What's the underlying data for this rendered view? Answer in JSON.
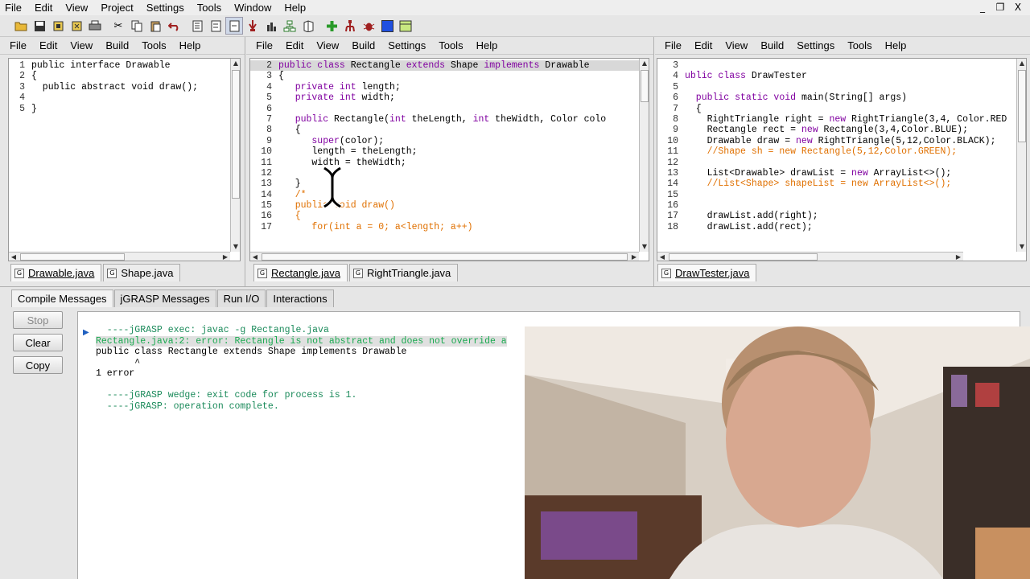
{
  "app_menu": [
    "File",
    "Edit",
    "View",
    "Project",
    "Settings",
    "Tools",
    "Window",
    "Help"
  ],
  "window_controls": [
    "_",
    "❐",
    "X"
  ],
  "toolbar_icons": [
    "open-folder-icon",
    "save-icon",
    "open-file-icon",
    "close-file-icon",
    "print-icon",
    "cut-icon",
    "copy-icon",
    "paste-icon",
    "undo-icon",
    "generate-csd-icon",
    "remove-csd-icon",
    "fold-icon",
    "browse-icon",
    "compile-icon",
    "uml-icon",
    "jar-icon",
    "compile-plus-icon",
    "debug-icon",
    "bug-icon",
    "run-icon",
    "window-icon"
  ],
  "panes": [
    {
      "menu": [
        "File",
        "Edit",
        "View",
        "Build",
        "Tools",
        "Help"
      ],
      "lines": [
        {
          "n": "1",
          "parts": [
            [
              "pl",
              "public interface Drawable"
            ]
          ]
        },
        {
          "n": "2",
          "parts": [
            [
              "pl",
              "{"
            ]
          ]
        },
        {
          "n": "3",
          "parts": [
            [
              "pl",
              "  public abstract void draw();"
            ]
          ]
        },
        {
          "n": "4",
          "parts": [
            [
              "pl",
              ""
            ]
          ]
        },
        {
          "n": "5",
          "parts": [
            [
              "pl",
              "}"
            ]
          ]
        }
      ],
      "tabs": [
        "Drawable.java",
        "Shape.java"
      ]
    },
    {
      "menu": [
        "File",
        "Edit",
        "View",
        "Build",
        "Settings",
        "Tools",
        "Help"
      ],
      "lines": [
        {
          "n": "2",
          "parts": [
            [
              "kw",
              "public class "
            ],
            [
              "pl",
              "Rectangle "
            ],
            [
              "kw",
              "extends "
            ],
            [
              "pl",
              "Shape "
            ],
            [
              "kw",
              "implements "
            ],
            [
              "pl",
              "Drawable"
            ]
          ],
          "hl": true
        },
        {
          "n": "3",
          "parts": [
            [
              "pl",
              "{"
            ]
          ]
        },
        {
          "n": "4",
          "parts": [
            [
              "kw",
              "   private int "
            ],
            [
              "pl",
              "length;"
            ]
          ]
        },
        {
          "n": "5",
          "parts": [
            [
              "kw",
              "   private int "
            ],
            [
              "pl",
              "width;"
            ]
          ]
        },
        {
          "n": "6",
          "parts": [
            [
              "pl",
              ""
            ]
          ]
        },
        {
          "n": "7",
          "parts": [
            [
              "kw",
              "   public "
            ],
            [
              "pl",
              "Rectangle("
            ],
            [
              "kw",
              "int "
            ],
            [
              "pl",
              "theLength, "
            ],
            [
              "kw",
              "int "
            ],
            [
              "pl",
              "theWidth, Color colo"
            ]
          ]
        },
        {
          "n": "8",
          "parts": [
            [
              "pl",
              "   {"
            ]
          ]
        },
        {
          "n": "9",
          "parts": [
            [
              "kw",
              "      super"
            ],
            [
              "pl",
              "(color);"
            ]
          ]
        },
        {
          "n": "10",
          "parts": [
            [
              "pl",
              "      length = theLength;"
            ]
          ]
        },
        {
          "n": "11",
          "parts": [
            [
              "pl",
              "      width = theWidth;"
            ]
          ]
        },
        {
          "n": "12",
          "parts": [
            [
              "pl",
              ""
            ]
          ]
        },
        {
          "n": "13",
          "parts": [
            [
              "pl",
              "   }"
            ]
          ]
        },
        {
          "n": "14",
          "parts": [
            [
              "cm",
              "   /*"
            ]
          ]
        },
        {
          "n": "15",
          "parts": [
            [
              "cm",
              "   public void draw()"
            ]
          ]
        },
        {
          "n": "16",
          "parts": [
            [
              "cm",
              "   {"
            ]
          ]
        },
        {
          "n": "17",
          "parts": [
            [
              "cm",
              "      for(int a = 0; a<length; a++)"
            ]
          ]
        }
      ],
      "tabs": [
        "Rectangle.java",
        "RightTriangle.java"
      ]
    },
    {
      "menu": [
        "File",
        "Edit",
        "View",
        "Build",
        "Settings",
        "Tools",
        "Help"
      ],
      "lines": [
        {
          "n": "3",
          "parts": [
            [
              "pl",
              ""
            ]
          ]
        },
        {
          "n": "4",
          "parts": [
            [
              "kw",
              "ublic class "
            ],
            [
              "pl",
              "DrawTester"
            ]
          ]
        },
        {
          "n": "5",
          "parts": [
            [
              "pl",
              ""
            ]
          ]
        },
        {
          "n": "6",
          "parts": [
            [
              "kw",
              "  public static void "
            ],
            [
              "pl",
              "main(String[] args)"
            ]
          ]
        },
        {
          "n": "7",
          "parts": [
            [
              "pl",
              "  {"
            ]
          ]
        },
        {
          "n": "8",
          "parts": [
            [
              "pl",
              "    RightTriangle right = "
            ],
            [
              "kw",
              "new "
            ],
            [
              "pl",
              "RightTriangle(3,4, Color.RED"
            ]
          ]
        },
        {
          "n": "9",
          "parts": [
            [
              "pl",
              "    Rectangle rect = "
            ],
            [
              "kw",
              "new "
            ],
            [
              "pl",
              "Rectangle(3,4,Color.BLUE);"
            ]
          ]
        },
        {
          "n": "10",
          "parts": [
            [
              "pl",
              "    Drawable draw = "
            ],
            [
              "kw",
              "new "
            ],
            [
              "pl",
              "RightTriangle(5,12,Color.BLACK);"
            ]
          ]
        },
        {
          "n": "11",
          "parts": [
            [
              "cm",
              "    //Shape sh = new Rectangle(5,12,Color.GREEN);"
            ]
          ]
        },
        {
          "n": "12",
          "parts": [
            [
              "pl",
              ""
            ]
          ]
        },
        {
          "n": "13",
          "parts": [
            [
              "pl",
              "    List<Drawable> drawList = "
            ],
            [
              "kw",
              "new "
            ],
            [
              "pl",
              "ArrayList<>();"
            ]
          ]
        },
        {
          "n": "14",
          "parts": [
            [
              "cm",
              "    //List<Shape> shapeList = new ArrayList<>();"
            ]
          ]
        },
        {
          "n": "15",
          "parts": [
            [
              "pl",
              ""
            ]
          ]
        },
        {
          "n": "16",
          "parts": [
            [
              "pl",
              ""
            ]
          ]
        },
        {
          "n": "17",
          "parts": [
            [
              "pl",
              "    drawList.add(right);"
            ]
          ]
        },
        {
          "n": "18",
          "parts": [
            [
              "pl",
              "    drawList.add(rect);"
            ]
          ]
        }
      ],
      "tabs": [
        "DrawTester.java"
      ]
    }
  ],
  "bottom_tabs": [
    "Compile Messages",
    "jGRASP Messages",
    "Run I/O",
    "Interactions"
  ],
  "side_buttons": {
    "stop": "Stop",
    "clear": "Clear",
    "copy": "Copy"
  },
  "messages": [
    {
      "text": "  ----jGRASP exec: javac -g Rectangle.java",
      "cls": "green"
    },
    {
      "text": "Rectangle.java:2: error: Rectangle is not abstract and does not override a",
      "cls": "errhl"
    },
    {
      "text": "public class Rectangle extends Shape implements Drawable",
      "cls": ""
    },
    {
      "text": "       ^",
      "cls": ""
    },
    {
      "text": "1 error",
      "cls": ""
    },
    {
      "text": "",
      "cls": ""
    },
    {
      "text": "  ----jGRASP wedge: exit code for process is 1.",
      "cls": "green"
    },
    {
      "text": "  ----jGRASP: operation complete.",
      "cls": "green"
    }
  ],
  "colors": {
    "keyword": "#8000a0",
    "comment": "#e07000",
    "message_green": "#1a8a5a"
  }
}
